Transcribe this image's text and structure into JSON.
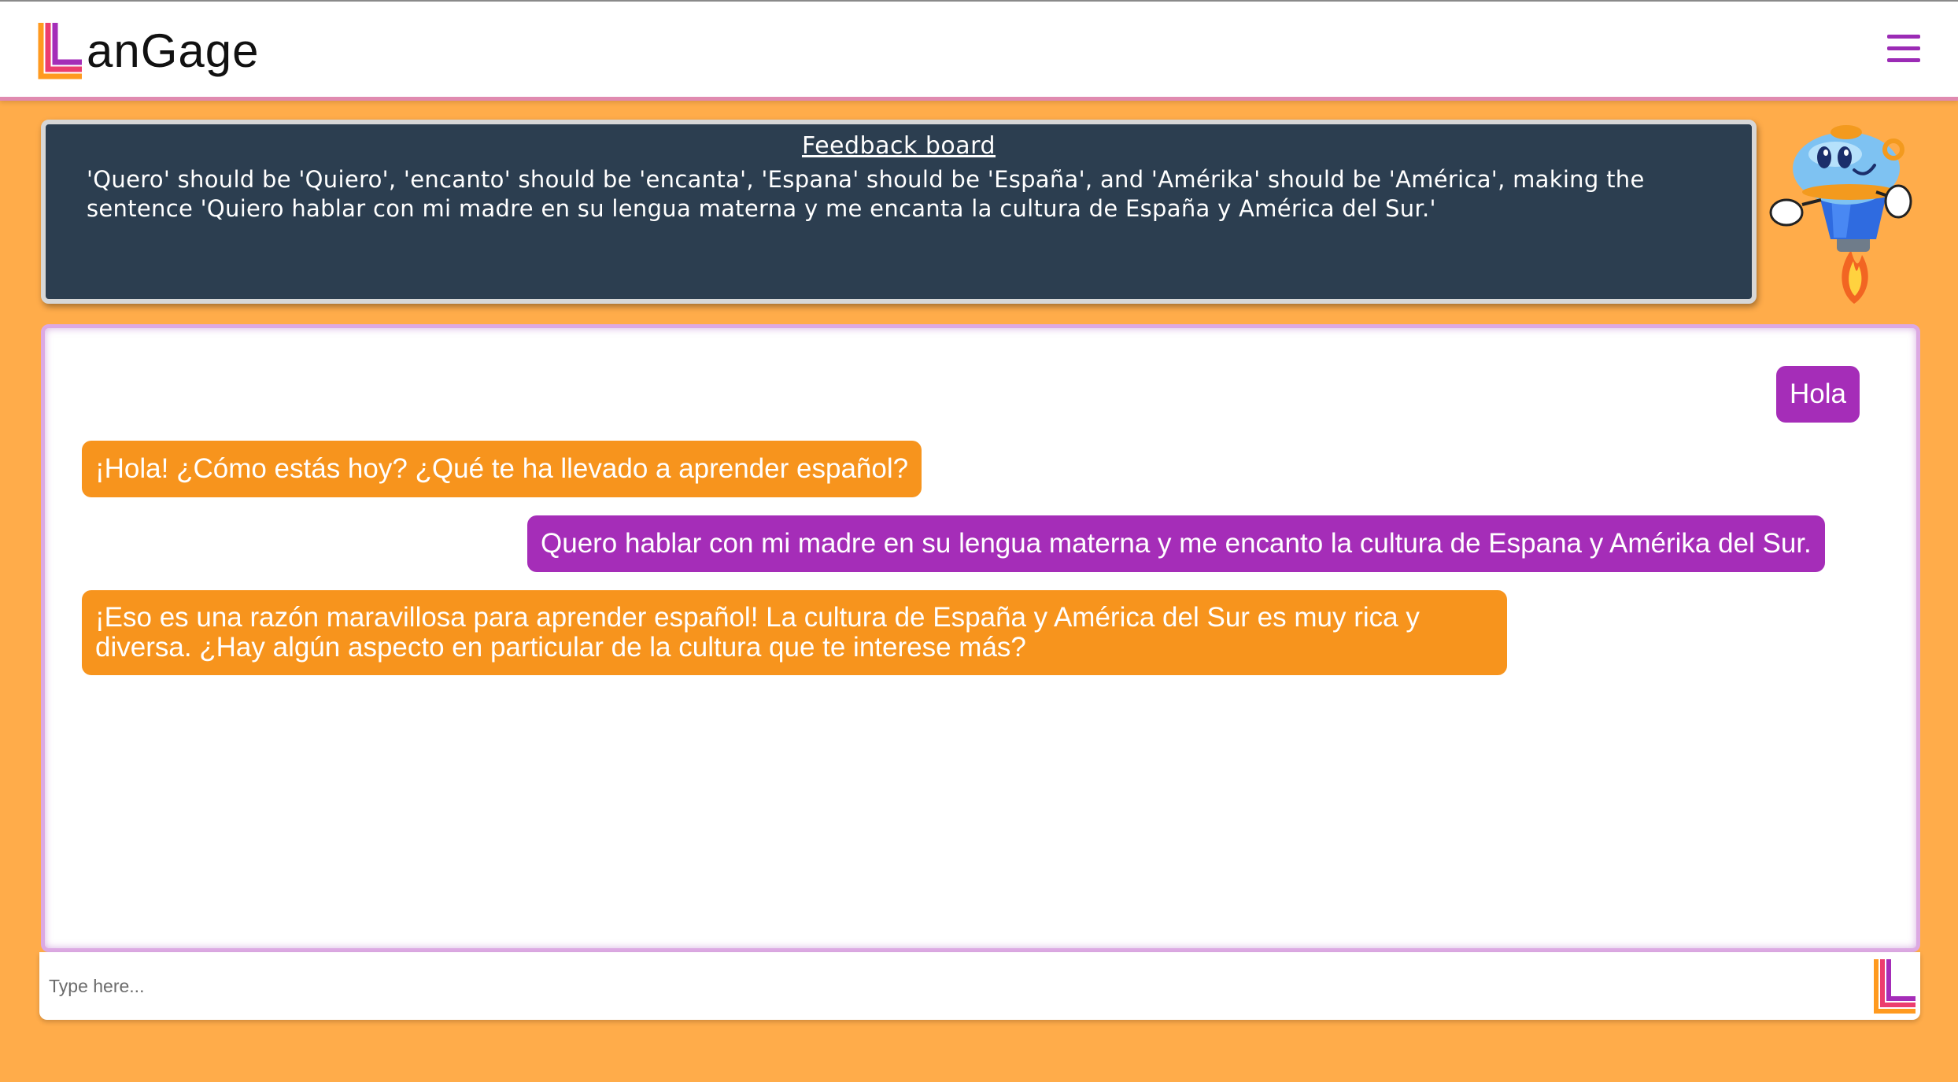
{
  "header": {
    "brand_name": "anGage",
    "logo_icon": "langage-l-logo-icon",
    "menu_icon": "hamburger-menu-icon"
  },
  "feedback": {
    "title": "Feedback board",
    "text": "'Quero' should be 'Quiero', 'encanto' should be 'encanta', 'Espana' should be 'España', and 'Amérika' should be 'América', making the sentence 'Quiero hablar con mi madre en su lengua materna y me encanta la cultura de España y América del Sur.'"
  },
  "mascot": {
    "icon": "robot-rocket-mascot-icon"
  },
  "chat": {
    "messages": [
      {
        "role": "user",
        "text": "Hola"
      },
      {
        "role": "bot",
        "text": "¡Hola! ¿Cómo estás hoy? ¿Qué te ha llevado a aprender español?"
      },
      {
        "role": "user",
        "text": "Quero hablar con mi madre en su lengua materna y me encanto la cultura de Espana y Amérika del Sur."
      },
      {
        "role": "bot",
        "text": "¡Eso es una razón maravillosa para aprender español! La cultura de España y América del Sur es muy rica y diversa. ¿Hay algún aspecto en particular de la cultura que te interese más?"
      }
    ]
  },
  "input": {
    "placeholder": "Type here...",
    "value": "",
    "send_icon": "langage-l-send-icon"
  },
  "colors": {
    "background": "#FFAC4A",
    "user_bubble": "#A52DB8",
    "bot_bubble": "#F7941D",
    "board": "#2C3E50",
    "accent": "#9B2BB5"
  }
}
